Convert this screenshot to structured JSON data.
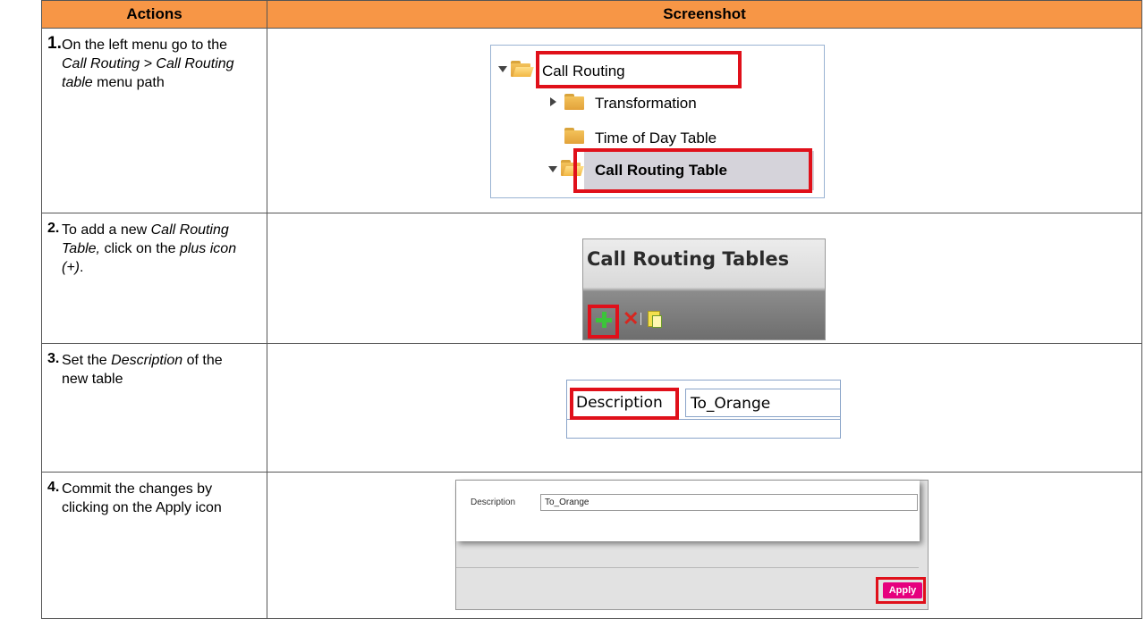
{
  "header": {
    "actions": "Actions",
    "screenshot": "Screenshot"
  },
  "steps": [
    {
      "num": "1.",
      "text_a": "On the left menu go to the ",
      "text_b": "Call Routing > Call Routing table",
      "text_c": " menu path"
    },
    {
      "num": "2.",
      "text_a": "To add a new ",
      "text_b": "Call Routing Table,",
      "text_c": " click on the ",
      "text_d": "plus icon (+)",
      "text_e": "."
    },
    {
      "num": "3.",
      "text_a": "Set the ",
      "text_b": "Description",
      "text_c": " of the new table"
    },
    {
      "num": "4.",
      "text_a": "Commit the changes by clicking on the Apply icon"
    }
  ],
  "shot1": {
    "items": [
      "Call Routing",
      "Transformation",
      "Time of Day Table",
      "Call Routing Table"
    ]
  },
  "shot2": {
    "title": "Call Routing Tables"
  },
  "shot3": {
    "label": "Description",
    "value": "To_Orange"
  },
  "shot4": {
    "label": "Description",
    "value": "To_Orange",
    "button": "Apply"
  },
  "colors": {
    "header_bg": "#f79646",
    "highlight": "#e0101a",
    "apply_bg": "#e6007e"
  }
}
